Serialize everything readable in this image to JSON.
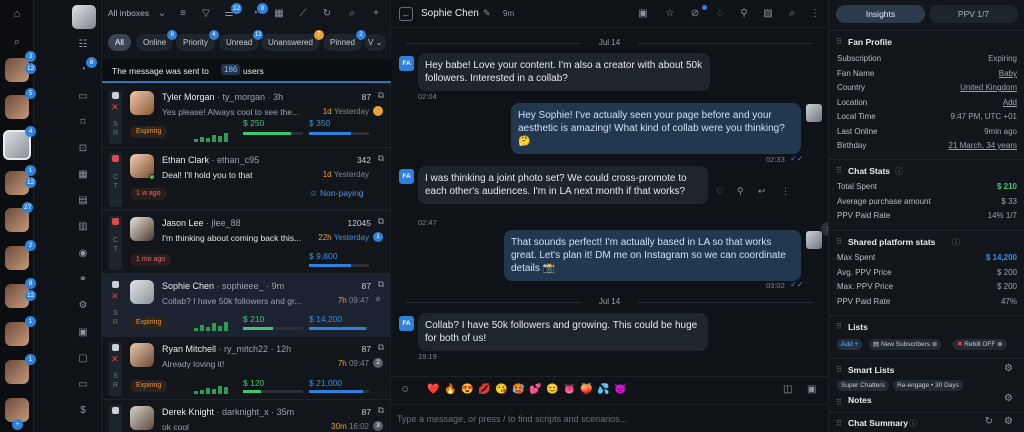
{
  "rail": {
    "badges": [
      "3",
      "12",
      "5",
      "4",
      "1",
      "12",
      "27",
      "2",
      "8",
      "12",
      "1",
      "1"
    ]
  },
  "side": {
    "badge": "8"
  },
  "list": {
    "inbox_label": "All inboxes",
    "header_badges": [
      "12",
      "8"
    ],
    "chips": [
      {
        "label": "All",
        "badge": ""
      },
      {
        "label": "Online",
        "badge": "8"
      },
      {
        "label": "Priority",
        "badge": "4"
      },
      {
        "label": "Unread",
        "badge": "12"
      },
      {
        "label": "Unanswered",
        "badge": "7"
      },
      {
        "label": "Pinned",
        "badge": "2"
      },
      {
        "label": "V",
        "badge": ""
      }
    ],
    "sent_prefix": "The message was sent to",
    "sent_count": "186",
    "sent_suffix": "users",
    "rows": [
      {
        "name": "Tyler Morgan",
        "handle": "· ty_morgan",
        "ago": "· 3h",
        "count": "87",
        "letters": "S\nR",
        "msg": "Yes please! Always cool to see the...",
        "time": "1d",
        "yesterday": "Yesterday",
        "tag": "Expiring",
        "amt1": "$ 250",
        "amt2": "$ 350",
        "fill1": 0.8,
        "fill2": 0.7
      },
      {
        "name": "Ethan Clark",
        "handle": "· ethan_c95",
        "ago": "",
        "count": "342",
        "letters": "C\nT",
        "msg": "Deal! I'll hold you to that",
        "time": "1d",
        "yesterday": "Yesterday",
        "tag": "1 w ago",
        "nonpay": "Non-paying"
      },
      {
        "name": "Jason Lee",
        "handle": "· jlee_88",
        "ago": "",
        "count": "12045",
        "letters": "C\nT",
        "msg": "I'm thinking about coming back this...",
        "time": "22h",
        "yesterday": "Yesterday",
        "badge": "1",
        "tag": "1 mo ago",
        "amt1": "",
        "amt2": "$ 9,800",
        "fill2": 0.7
      },
      {
        "name": "Sophie Chen",
        "handle": "· sophieee_",
        "ago": "· 9m",
        "count": "87",
        "letters": "S\nR",
        "msg": "Collab? I have 50k followers and gr...",
        "time": "7h",
        "yesterday": "09:47",
        "tag": "Expiring",
        "amt1": "$ 210",
        "amt2": "$ 14,200",
        "fill1": 0.5,
        "fill2": 0.95
      },
      {
        "name": "Ryan Mitchell",
        "handle": "· ry_mitch22",
        "ago": "· 12h",
        "count": "87",
        "letters": "S\nR",
        "msg": "Already loving it!",
        "time": "7h",
        "yesterday": "09:47",
        "badge": "2",
        "tag": "Expiring",
        "amt1": "$ 120",
        "amt2": "$ 21,000",
        "fill1": 0.3,
        "fill2": 0.9
      },
      {
        "name": "Derek Knight",
        "handle": "· darknight_x",
        "ago": "· 35m",
        "count": "87",
        "letters": "",
        "msg": "ok cool",
        "time": "30m",
        "yesterday": "16:02",
        "badge": "3"
      }
    ]
  },
  "chat": {
    "name": "Sophie Chen",
    "ago": "9m",
    "date1": "Jul 14",
    "date2": "Jul 14",
    "fa": "FA",
    "messages": [
      {
        "dir": "in",
        "text": "Hey babe! Love your content. I'm also a creator with about 50k followers. Interested in a collab?",
        "time": "02:04"
      },
      {
        "dir": "out",
        "text": "Hey Sophie! I've actually seen your page before and your aesthetic is amazing! What kind of collab were you thinking? 🤔",
        "time": "02:33"
      },
      {
        "dir": "in",
        "text": "I was thinking a joint photo set? We could cross-promote to each other's audiences. I'm in LA next month if that works?",
        "time": "02:47"
      },
      {
        "dir": "out",
        "text": "That sounds perfect! I'm actually based in LA so that works great. Let's plan it! DM me on Instagram so we can coordinate details 📸",
        "time": "03:02"
      },
      {
        "dir": "in",
        "text": "Collab? I have 50k followers and growing. This could be huge for both of us!",
        "time": "19:19"
      }
    ],
    "emojis": [
      "❤️",
      "🔥",
      "😍",
      "💋",
      "😘",
      "🥵",
      "💕",
      "😊",
      "👅",
      "🍑",
      "💦",
      "😈"
    ],
    "placeholder": "Type a message, or press / to find scripts and scenarios..."
  },
  "panel": {
    "tab_insights": "Insights",
    "tab_ppv": "PPV 1/7",
    "fan_profile": {
      "title": "Fan Profile",
      "rows": [
        {
          "k": "Subscription",
          "v": "Expiring"
        },
        {
          "k": "Fan Name",
          "v": "Baby"
        },
        {
          "k": "Country",
          "v": "United Kingdom"
        },
        {
          "k": "Location",
          "v": "Add"
        },
        {
          "k": "Local Time",
          "v": "9:47 PM, UTC +01"
        },
        {
          "k": "Last Online",
          "v": "9min ago"
        },
        {
          "k": "Birthday",
          "v": "21 March, 34 years"
        }
      ]
    },
    "chat_stats": {
      "title": "Chat Stats",
      "rows": [
        {
          "k": "Total Spent",
          "v": "$ 210"
        },
        {
          "k": "Average purchase amount",
          "v": "$ 33"
        },
        {
          "k": "PPV Paid Rate",
          "v": "14%  1/7"
        }
      ]
    },
    "shared": {
      "title": "Shared platform stats",
      "rows": [
        {
          "k": "Max Spent",
          "v": "$ 14,200"
        },
        {
          "k": "Avg. PPV Price",
          "v": "$ 200"
        },
        {
          "k": "Max. PPV Price",
          "v": "$ 200"
        },
        {
          "k": "PPV Paid Rate",
          "v": "47%"
        }
      ]
    },
    "lists": {
      "title": "Lists",
      "add": "Add +",
      "items": [
        "New Subscribers",
        "Rebill OFF"
      ]
    },
    "smart_lists": {
      "title": "Smart Lists",
      "items": [
        "Super Chatters",
        "Re-engage • 30 Days"
      ]
    },
    "notes": {
      "title": "Notes"
    },
    "summary": {
      "title": "Chat Summary"
    }
  }
}
